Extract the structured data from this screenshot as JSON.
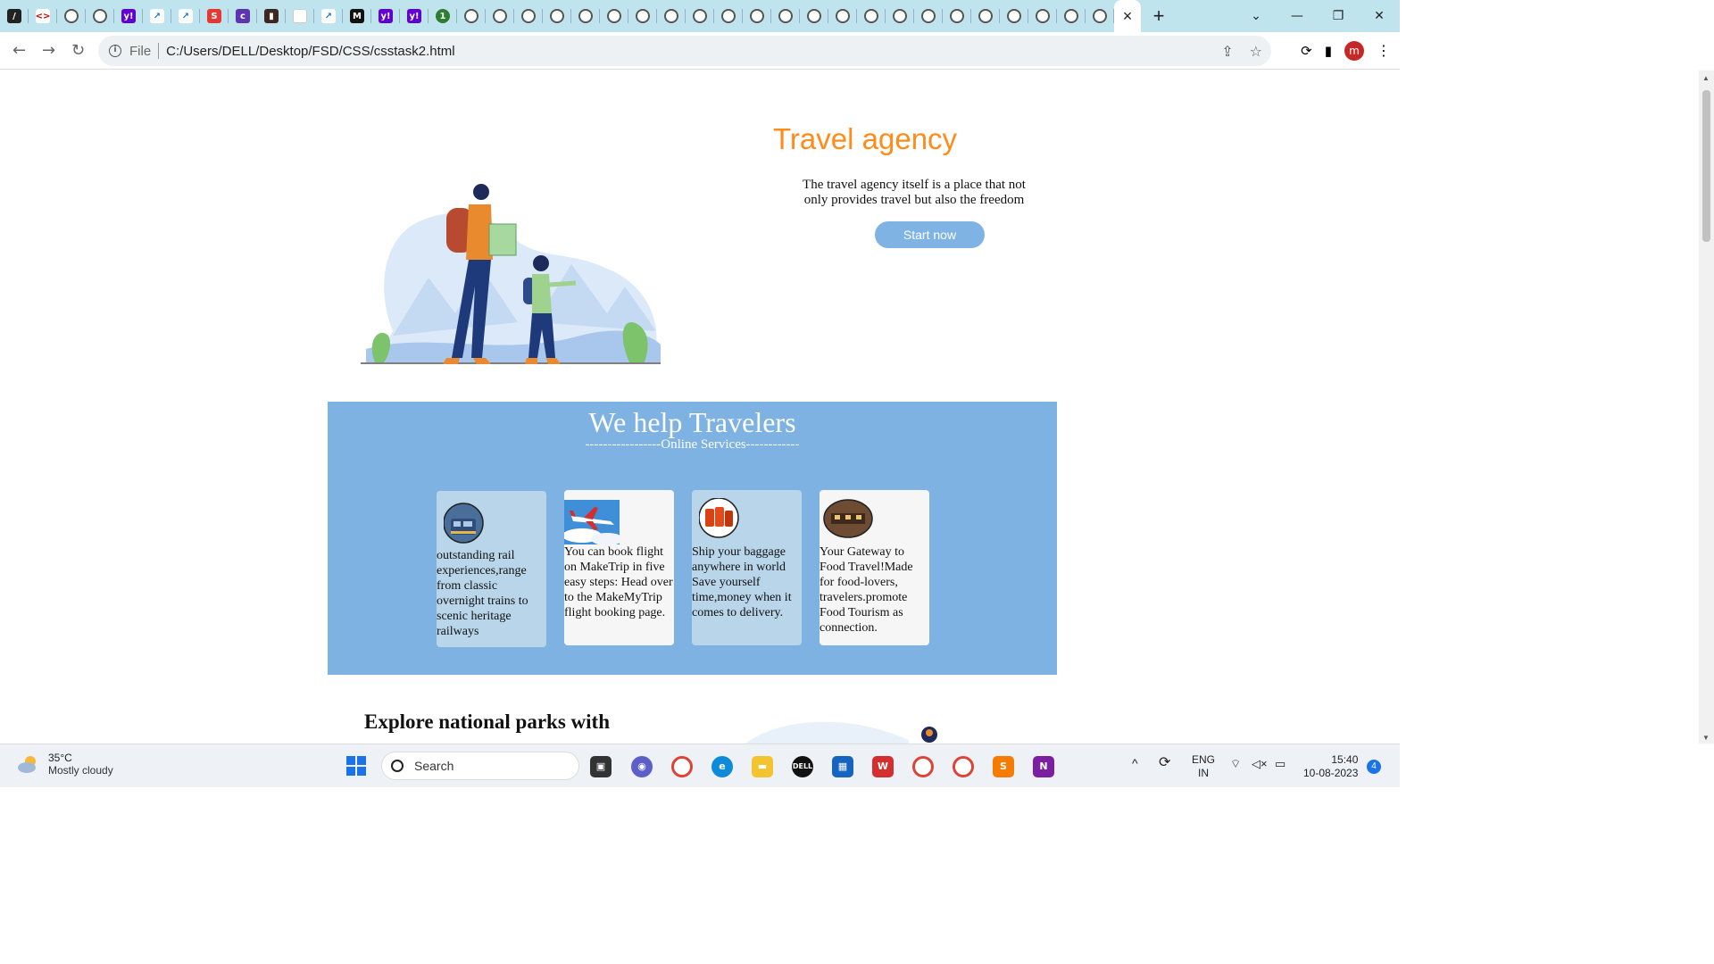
{
  "browser": {
    "tab_close": "×",
    "new_tab": "+",
    "omnibox": {
      "scheme": "File",
      "url": "C:/Users/DELL/Desktop/FSD/CSS/csstask2.html"
    },
    "profile_initial": "m"
  },
  "page": {
    "hero": {
      "title": "Travel agency",
      "text": "The travel agency itself is a place that not only provides travel but also the freedom",
      "cta": "Start now"
    },
    "services": {
      "heading": "We help Travelers",
      "subheading": "-----------------Online Services------------",
      "cards": [
        {
          "text": "outstanding rail experiences,range from classic overnight trains to scenic heritage railways",
          "image_icon": "train-photo"
        },
        {
          "text": "You can book flight on MakeTrip in five easy steps: Head over to the MakeMyTrip flight booking page.",
          "image_icon": "airplane-photo"
        },
        {
          "text": "Ship your baggage anywhere in world Save yourself time,money when it comes to delivery.",
          "image_icon": "luggage-photo"
        },
        {
          "text": "Your Gateway to Food Travel!Made for food-lovers, travelers.promote Food Tourism as connection.",
          "image_icon": "restaurant-photo"
        }
      ]
    },
    "explore": {
      "heading": "Explore national parks with"
    }
  },
  "taskbar": {
    "weather": {
      "temp": "35°C",
      "condition": "Mostly cloudy"
    },
    "search_placeholder": "Search",
    "lang": "ENG",
    "region": "IN",
    "time": "15:40",
    "date": "10-08-2023",
    "notification_count": "4"
  },
  "colors": {
    "tabstrip": "#bfe4ee",
    "accent_orange": "#ff8c1a",
    "services_blue": "#7db2e2",
    "button_blue": "#7eb3e4"
  }
}
